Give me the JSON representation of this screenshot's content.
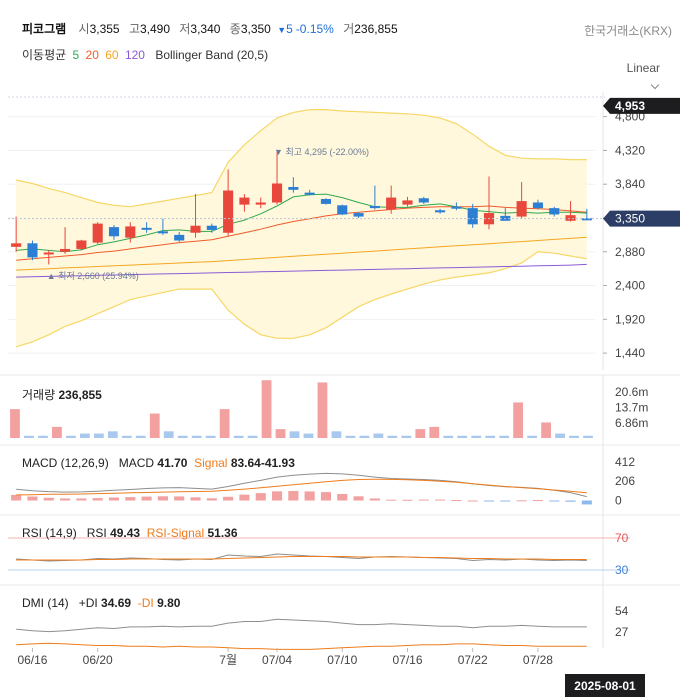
{
  "header": {
    "name": "피코그램",
    "open_label": "시",
    "open": "3,355",
    "high_label": "고",
    "high": "3,490",
    "low_label": "저",
    "low": "3,340",
    "close_label": "종",
    "close": "3,350",
    "change_arrow": "▼",
    "change": "5",
    "change_pct": "-0.15%",
    "volume_label": "거",
    "volume": "236,855",
    "exchange": "한국거래소(KRX)"
  },
  "indicators_line": {
    "ma_label": "이동평균",
    "ma_periods": [
      "5",
      "20",
      "60",
      "120"
    ],
    "ma_colors": [
      "#2fa84f",
      "#ef5b2b",
      "#f4a623",
      "#8a5bd6"
    ],
    "bb_label": "Bollinger Band (20,5)"
  },
  "scale_mode": "Linear",
  "colors": {
    "up": "#e8473b",
    "down": "#2d7fd3",
    "accent_tag": "#2c3e66",
    "bb_fill": "#fff8dc",
    "bb_line": "#f6d767"
  },
  "chart_data": {
    "type": "candlestick",
    "x_tick_labels": [
      "06/16",
      "06/20",
      "7월",
      "07/04",
      "07/10",
      "07/16",
      "07/22",
      "07/28"
    ],
    "x_tick_index": [
      1,
      5,
      13,
      16,
      20,
      24,
      28,
      32
    ],
    "current_date": "2025-08-01",
    "price_axis": {
      "range": [
        1200,
        5150
      ],
      "ticks": [
        "4,800",
        "4,320",
        "3,840",
        "3,360",
        "2,880",
        "2,400",
        "1,920",
        "1,440"
      ],
      "tick_values": [
        4800,
        4320,
        3840,
        3360,
        2880,
        2400,
        1920,
        1440
      ],
      "top_tag": "4,953",
      "top_tag_value": 4953,
      "last_tag": "3,350",
      "last_tag_value": 3350
    },
    "max_annotation": "▼ 최고 4,295 (-22.00%)",
    "max_value": 4295,
    "max_index": 16,
    "min_annotation": "▲ 최저 2,660 (25.94%)",
    "min_value": 2660,
    "min_index": 2,
    "candles": [
      {
        "o": 2950,
        "h": 3380,
        "l": 2880,
        "c": 3000
      },
      {
        "o": 3000,
        "h": 3040,
        "l": 2760,
        "c": 2800
      },
      {
        "o": 2850,
        "h": 2900,
        "l": 2700,
        "c": 2870
      },
      {
        "o": 2880,
        "h": 3230,
        "l": 2850,
        "c": 2920
      },
      {
        "o": 2920,
        "h": 3050,
        "l": 2900,
        "c": 3040
      },
      {
        "o": 3010,
        "h": 3300,
        "l": 2990,
        "c": 3280
      },
      {
        "o": 3230,
        "h": 3260,
        "l": 3050,
        "c": 3100
      },
      {
        "o": 3080,
        "h": 3300,
        "l": 3010,
        "c": 3240
      },
      {
        "o": 3220,
        "h": 3300,
        "l": 3150,
        "c": 3200
      },
      {
        "o": 3170,
        "h": 3350,
        "l": 3120,
        "c": 3150
      },
      {
        "o": 3120,
        "h": 3160,
        "l": 3020,
        "c": 3040
      },
      {
        "o": 3150,
        "h": 3700,
        "l": 3080,
        "c": 3250
      },
      {
        "o": 3250,
        "h": 3280,
        "l": 3150,
        "c": 3190
      },
      {
        "o": 3150,
        "h": 4050,
        "l": 3100,
        "c": 3750
      },
      {
        "o": 3550,
        "h": 3700,
        "l": 3450,
        "c": 3650
      },
      {
        "o": 3550,
        "h": 3650,
        "l": 3500,
        "c": 3580
      },
      {
        "o": 3580,
        "h": 4295,
        "l": 3550,
        "c": 3850
      },
      {
        "o": 3800,
        "h": 3940,
        "l": 3720,
        "c": 3760
      },
      {
        "o": 3720,
        "h": 3760,
        "l": 3680,
        "c": 3690
      },
      {
        "o": 3630,
        "h": 3640,
        "l": 3550,
        "c": 3560
      },
      {
        "o": 3540,
        "h": 3550,
        "l": 3400,
        "c": 3410
      },
      {
        "o": 3430,
        "h": 3440,
        "l": 3360,
        "c": 3380
      },
      {
        "o": 3530,
        "h": 3820,
        "l": 3480,
        "c": 3500
      },
      {
        "o": 3480,
        "h": 3820,
        "l": 3420,
        "c": 3650
      },
      {
        "o": 3550,
        "h": 3660,
        "l": 3520,
        "c": 3610
      },
      {
        "o": 3640,
        "h": 3660,
        "l": 3560,
        "c": 3580
      },
      {
        "o": 3470,
        "h": 3490,
        "l": 3420,
        "c": 3440
      },
      {
        "o": 3520,
        "h": 3580,
        "l": 3470,
        "c": 3500
      },
      {
        "o": 3500,
        "h": 3560,
        "l": 3220,
        "c": 3270
      },
      {
        "o": 3270,
        "h": 3950,
        "l": 3200,
        "c": 3430
      },
      {
        "o": 3390,
        "h": 3500,
        "l": 3350,
        "c": 3320
      },
      {
        "o": 3380,
        "h": 3870,
        "l": 3350,
        "c": 3600
      },
      {
        "o": 3580,
        "h": 3620,
        "l": 3480,
        "c": 3500
      },
      {
        "o": 3500,
        "h": 3520,
        "l": 3380,
        "c": 3410
      },
      {
        "o": 3320,
        "h": 3600,
        "l": 3310,
        "c": 3400
      },
      {
        "o": 3355,
        "h": 3490,
        "l": 3340,
        "c": 3350
      }
    ],
    "ma5": [
      2900,
      2920,
      2900,
      2880,
      2910,
      2980,
      3020,
      3070,
      3120,
      3180,
      3190,
      3170,
      3170,
      3270,
      3330,
      3420,
      3530,
      3660,
      3690,
      3700,
      3650,
      3580,
      3520,
      3510,
      3510,
      3540,
      3560,
      3520,
      3470,
      3450,
      3430,
      3440,
      3430,
      3440,
      3440,
      3430
    ],
    "ma20": [
      2760,
      2780,
      2800,
      2820,
      2840,
      2870,
      2890,
      2920,
      2950,
      2980,
      3010,
      3030,
      3050,
      3100,
      3150,
      3200,
      3260,
      3310,
      3350,
      3390,
      3420,
      3440,
      3460,
      3480,
      3500,
      3510,
      3520,
      3520,
      3520,
      3530,
      3510,
      3500,
      3490,
      3480,
      3460,
      3440
    ],
    "ma60": [
      2620,
      2630,
      2640,
      2650,
      2660,
      2670,
      2680,
      2690,
      2700,
      2710,
      2720,
      2730,
      2740,
      2755,
      2770,
      2785,
      2800,
      2815,
      2830,
      2845,
      2860,
      2875,
      2890,
      2905,
      2920,
      2935,
      2950,
      2965,
      2980,
      2995,
      3010,
      3025,
      3040,
      3055,
      3070,
      3085
    ],
    "ma120": [
      2520,
      2525,
      2530,
      2535,
      2540,
      2545,
      2550,
      2555,
      2560,
      2565,
      2570,
      2575,
      2580,
      2585,
      2590,
      2595,
      2600,
      2605,
      2610,
      2615,
      2620,
      2625,
      2630,
      2635,
      2640,
      2645,
      2650,
      2655,
      2660,
      2665,
      2670,
      2675,
      2680,
      2685,
      2690,
      2700
    ],
    "bb_upper": [
      3900,
      3850,
      3780,
      3720,
      3650,
      3580,
      3540,
      3520,
      3560,
      3600,
      3640,
      3680,
      3720,
      4150,
      4400,
      4600,
      4780,
      4860,
      4900,
      4900,
      4880,
      4870,
      4860,
      4850,
      4840,
      4820,
      4780,
      4700,
      4550,
      4380,
      4250,
      4210,
      4200,
      4200,
      4190,
      4190
    ],
    "bb_lower": [
      1530,
      1600,
      1700,
      1820,
      1900,
      2000,
      2100,
      2200,
      2250,
      2300,
      2350,
      2350,
      2350,
      2050,
      1850,
      1700,
      1650,
      1650,
      1700,
      1800,
      1950,
      2100,
      2200,
      2280,
      2350,
      2420,
      2480,
      2520,
      2550,
      2580,
      2640,
      2720,
      2880,
      2860,
      2820,
      2780
    ],
    "volume": {
      "label": "거래량",
      "value": "236,855",
      "ticks": [
        "20.6m",
        "13.7m",
        "6.86m"
      ],
      "tick_values": [
        20.6,
        13.7,
        6.86
      ],
      "max": 27,
      "bars": [
        13,
        1,
        1,
        5,
        1,
        2,
        2,
        3,
        1,
        1,
        11,
        3,
        1,
        1,
        1,
        13,
        1,
        1,
        26,
        4,
        3,
        2,
        25,
        3,
        1,
        1,
        2,
        1,
        1,
        4,
        5,
        1,
        1,
        1,
        1,
        1,
        16,
        1,
        7,
        2,
        1,
        1
      ]
    },
    "macd": {
      "label": "MACD (12,26,9)",
      "macd_label": "MACD",
      "macd_value": "41.70",
      "signal_label": "Signal",
      "signal_value": "83.64-41.93",
      "ticks": [
        "412",
        "206",
        "0"
      ],
      "tick_values": [
        412,
        206,
        0
      ],
      "range": [
        -80,
        540
      ],
      "macd": [
        120,
        105,
        95,
        90,
        92,
        100,
        110,
        118,
        128,
        135,
        138,
        130,
        122,
        150,
        185,
        215,
        250,
        270,
        282,
        290,
        285,
        270,
        250,
        235,
        230,
        225,
        215,
        200,
        180,
        160,
        148,
        140,
        130,
        110,
        85,
        42
      ],
      "signal": [
        60,
        62,
        66,
        68,
        70,
        74,
        78,
        82,
        86,
        90,
        94,
        96,
        98,
        110,
        122,
        136,
        152,
        168,
        185,
        200,
        215,
        225,
        228,
        226,
        222,
        215,
        205,
        195,
        180,
        165,
        150,
        138,
        125,
        112,
        98,
        84
      ],
      "hist": [
        60,
        43,
        29,
        22,
        22,
        26,
        32,
        36,
        42,
        45,
        44,
        34,
        24,
        40,
        63,
        79,
        98,
        102,
        97,
        90,
        70,
        45,
        22,
        9,
        8,
        10,
        10,
        5,
        0,
        -5,
        -2,
        2,
        5,
        -2,
        -13,
        -42
      ]
    },
    "rsi": {
      "label": "RSI (14,9)",
      "rsi_label": "RSI",
      "rsi_value": "49.43",
      "signal_label": "RSI-Signal",
      "signal_value": "51.36",
      "ticks": [
        "70",
        "30"
      ],
      "tick_values": [
        70,
        30
      ],
      "range": [
        0,
        100
      ],
      "rsi": [
        52,
        50,
        48,
        49,
        50,
        53,
        52,
        54,
        53,
        51,
        50,
        52,
        51,
        60,
        58,
        57,
        62,
        60,
        58,
        57,
        55,
        53,
        56,
        57,
        56,
        55,
        54,
        53,
        49,
        51,
        50,
        52,
        50,
        49,
        50,
        49
      ],
      "signal": [
        50,
        50,
        50,
        50,
        50,
        51,
        51,
        52,
        52,
        52,
        52,
        52,
        52,
        53,
        54,
        55,
        56,
        57,
        57,
        57,
        57,
        56,
        56,
        56,
        56,
        55,
        55,
        54,
        53,
        53,
        52,
        52,
        52,
        51,
        51,
        51
      ]
    },
    "dmi": {
      "label": "DMI (14)",
      "pdi_label": "+DI",
      "pdi_value": "34.69",
      "mdi_label": "-DI",
      "mdi_value": "9.80",
      "ticks": [
        "54",
        "27"
      ],
      "tick_values": [
        54,
        27
      ],
      "range": [
        0,
        75
      ],
      "pdi": [
        32,
        30,
        29,
        30,
        32,
        34,
        33,
        35,
        35,
        36,
        35,
        36,
        36,
        40,
        42,
        42,
        45,
        44,
        43,
        42,
        40,
        38,
        38,
        39,
        38,
        37,
        36,
        36,
        34,
        36,
        36,
        37,
        36,
        35,
        35,
        35
      ],
      "mdi": [
        12,
        13,
        14,
        13,
        12,
        11,
        11,
        10,
        10,
        9,
        10,
        9,
        9,
        8,
        7,
        7,
        6,
        6,
        6,
        7,
        8,
        9,
        10,
        10,
        11,
        12,
        12,
        13,
        13,
        12,
        11,
        11,
        10,
        10,
        10,
        10
      ]
    }
  }
}
